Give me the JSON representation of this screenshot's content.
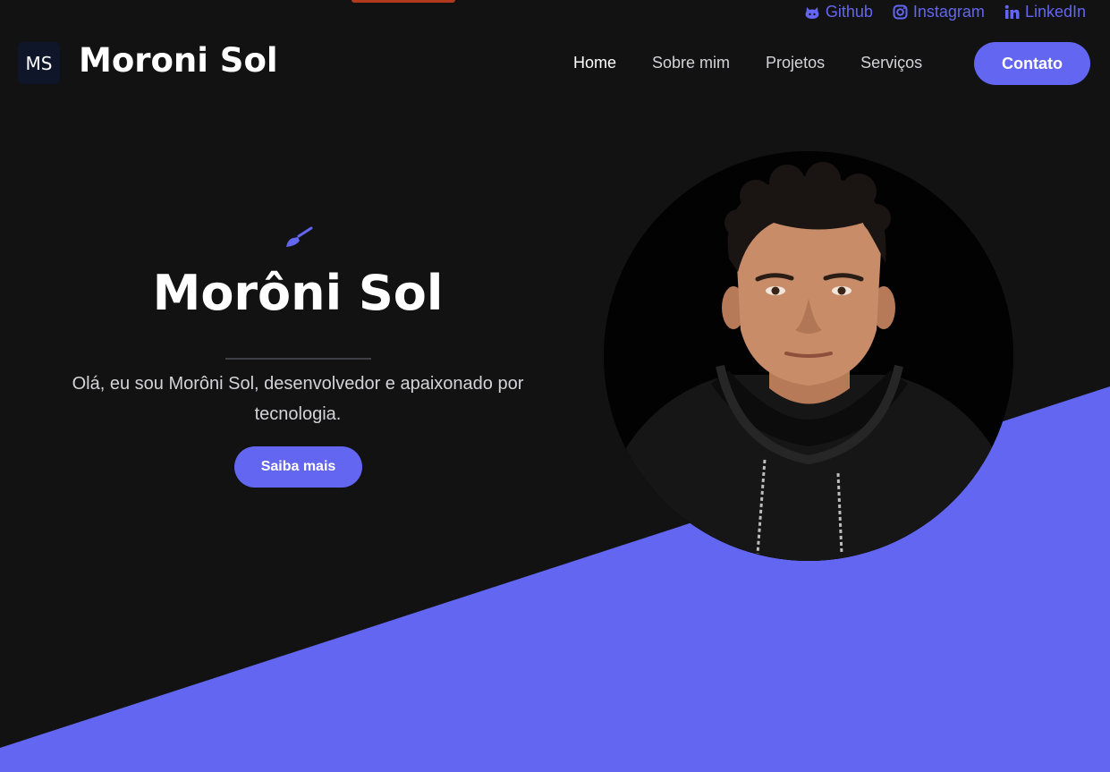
{
  "colors": {
    "background": "#121212",
    "accent": "#6366f1",
    "text": "#ffffff",
    "muted_text": "#d4d4d8"
  },
  "social": [
    {
      "label": "Github",
      "icon": "github-icon"
    },
    {
      "label": "Instagram",
      "icon": "instagram-icon"
    },
    {
      "label": "LinkedIn",
      "icon": "linkedin-icon"
    }
  ],
  "header": {
    "logo_text": "MS",
    "brand_name": "Moroni Sol",
    "nav": [
      {
        "label": "Home",
        "active": true
      },
      {
        "label": "Sobre mim",
        "active": false
      },
      {
        "label": "Projetos",
        "active": false
      },
      {
        "label": "Serviços",
        "active": false
      }
    ],
    "contact_label": "Contato"
  },
  "hero": {
    "icon": "paintbrush-icon",
    "title": "Morôni Sol",
    "description": "Olá, eu sou Morôni Sol, desenvolvedor e apaixonado por tecnologia.",
    "button_label": "Saiba mais"
  },
  "profile": {
    "image": "profile-photo"
  }
}
